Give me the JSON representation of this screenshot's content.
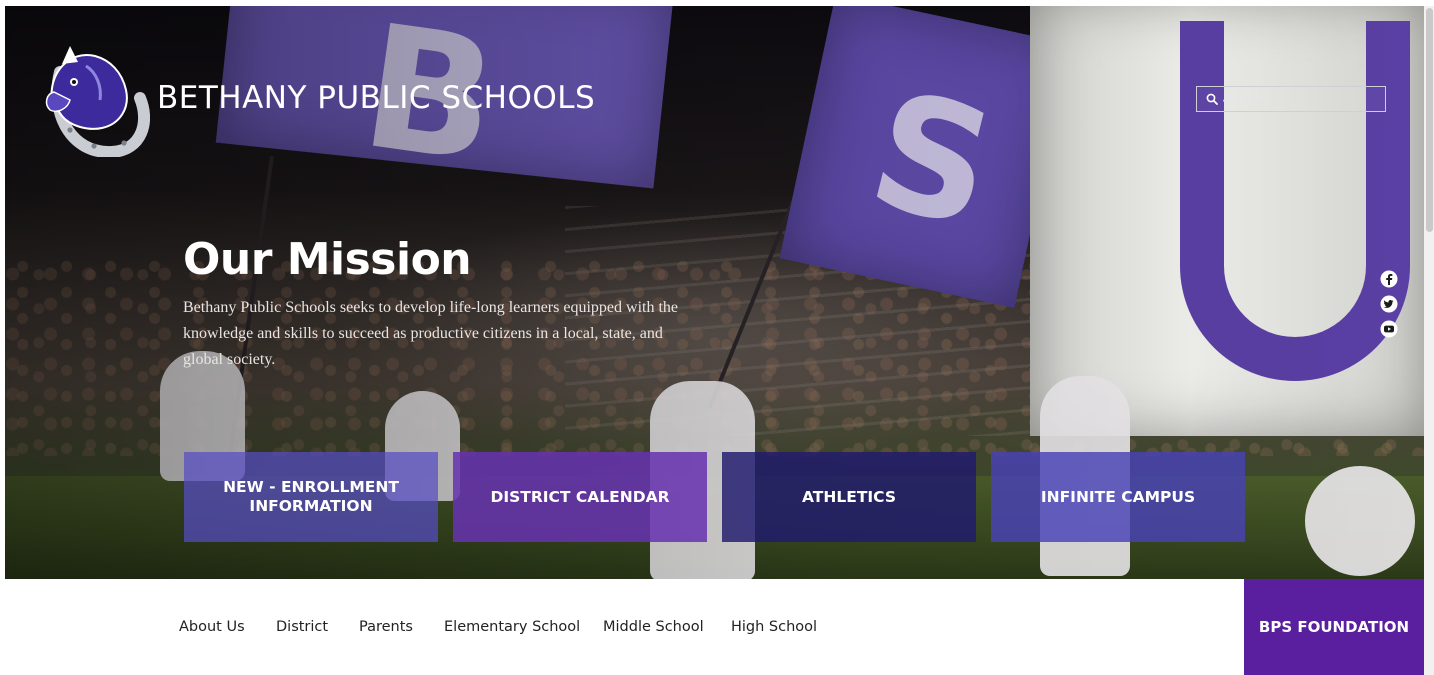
{
  "header": {
    "brand_name": "BETHANY PUBLIC SCHOOLS",
    "logo_icon": "horseshoe-mascot-logo",
    "search": {
      "placeholder": "Search",
      "value": ""
    }
  },
  "social": [
    {
      "name": "facebook-icon"
    },
    {
      "name": "twitter-icon"
    },
    {
      "name": "youtube-icon"
    }
  ],
  "mission": {
    "title": "Our Mission",
    "text": "Bethany Public Schools seeks to develop life-long learners equipped with the knowledge and skills to succeed as productive citizens in a local, state, and global society."
  },
  "tiles": [
    {
      "label": "NEW - ENROLLMENT INFORMATION",
      "color": "#564cc4"
    },
    {
      "label": "DISTRICT CALENDAR",
      "color": "#6632b0"
    },
    {
      "label": "ATHLETICS",
      "color": "#201a6e"
    },
    {
      "label": "INFINITE CAMPUS",
      "color": "#4842b6"
    }
  ],
  "nav": {
    "items": [
      {
        "label": "About Us"
      },
      {
        "label": "District"
      },
      {
        "label": "Parents"
      },
      {
        "label": "Elementary School"
      },
      {
        "label": "Middle School"
      },
      {
        "label": "High School"
      }
    ],
    "foundation_label": "BPS FOUNDATION",
    "foundation_color": "#5a1f9e"
  }
}
